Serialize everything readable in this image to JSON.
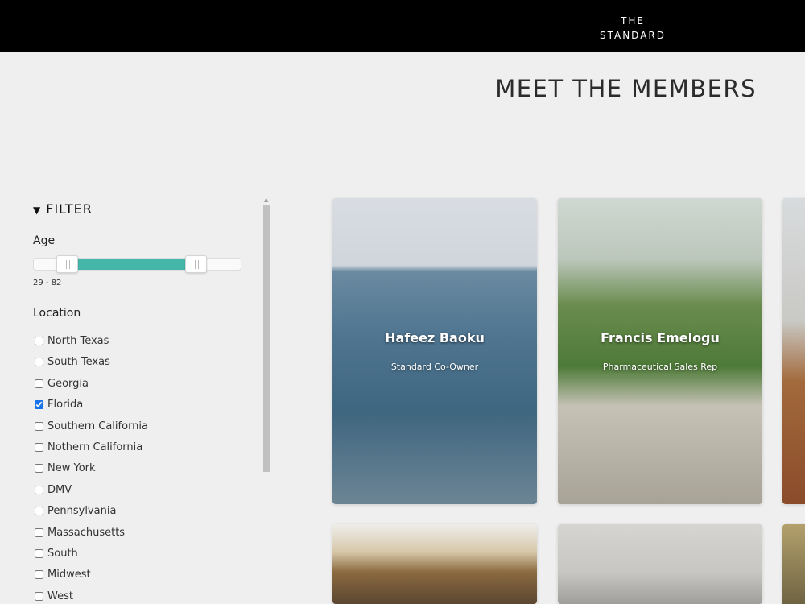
{
  "header": {
    "logo_line1": "THE",
    "logo_line2": "STANDARD"
  },
  "page_title": "MEET THE MEMBERS",
  "filter": {
    "title": "FILTER",
    "age_label": "Age",
    "age_min": 29,
    "age_max": 82,
    "age_range_text": "29 - 82",
    "location_label": "Location",
    "locations": [
      {
        "label": "North Texas",
        "checked": false
      },
      {
        "label": "South Texas",
        "checked": false
      },
      {
        "label": "Georgia",
        "checked": false
      },
      {
        "label": "Florida",
        "checked": true
      },
      {
        "label": "Southern California",
        "checked": false
      },
      {
        "label": "Nothern California",
        "checked": false
      },
      {
        "label": "New York",
        "checked": false
      },
      {
        "label": "DMV",
        "checked": false
      },
      {
        "label": "Pennsylvania",
        "checked": false
      },
      {
        "label": "Massachusetts",
        "checked": false
      },
      {
        "label": "South",
        "checked": false
      },
      {
        "label": "Midwest",
        "checked": false
      },
      {
        "label": "West",
        "checked": false
      }
    ]
  },
  "members": [
    {
      "name": "Hafeez Baoku",
      "role": "Standard Co-Owner"
    },
    {
      "name": "Francis Emelogu",
      "role": "Pharmaceutical Sales Rep"
    }
  ],
  "colors": {
    "slider_fill": "#45b7aa",
    "header_bg": "#000000",
    "page_bg": "#efefef"
  }
}
